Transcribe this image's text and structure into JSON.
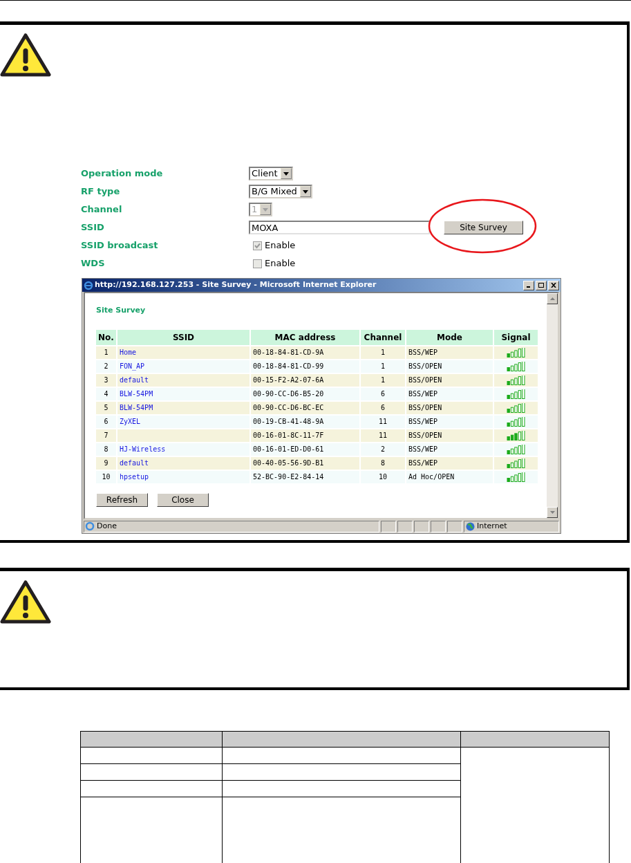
{
  "settings": [
    {
      "label": "Operation mode",
      "kind": "select",
      "value": "Client",
      "disabled": false
    },
    {
      "label": "RF type",
      "kind": "select",
      "value": "B/G Mixed",
      "disabled": false
    },
    {
      "label": "Channel",
      "kind": "select",
      "value": "1",
      "disabled": true
    },
    {
      "label": "SSID",
      "kind": "text",
      "value": "MOXA",
      "button": "Site Survey"
    },
    {
      "label": "SSID broadcast",
      "kind": "checkbox",
      "text": "Enable",
      "checked": true,
      "disabled": true
    },
    {
      "label": "WDS",
      "kind": "checkbox",
      "text": "Enable",
      "checked": false,
      "disabled": true
    }
  ],
  "popup": {
    "title": "http://192.168.127.253 - Site Survey - Microsoft Internet Explorer",
    "heading": "Site Survey",
    "columns": [
      "No.",
      "SSID",
      "MAC address",
      "Channel",
      "Mode",
      "Signal"
    ],
    "rows": [
      {
        "no": "1",
        "ssid": "Home",
        "mac": "00-18-84-81-CD-9A",
        "channel": "1",
        "mode": "BSS/WEP",
        "level": 0.2
      },
      {
        "no": "2",
        "ssid": "FON_AP",
        "mac": "00-18-84-81-CD-99",
        "channel": "1",
        "mode": "BSS/OPEN",
        "level": 0.2
      },
      {
        "no": "3",
        "ssid": "default",
        "mac": "00-15-F2-A2-07-6A",
        "channel": "1",
        "mode": "BSS/OPEN",
        "level": 0.2
      },
      {
        "no": "4",
        "ssid": "BLW-54PM",
        "mac": "00-90-CC-D6-B5-20",
        "channel": "6",
        "mode": "BSS/WEP",
        "level": 0.2
      },
      {
        "no": "5",
        "ssid": "BLW-54PM",
        "mac": "00-90-CC-D6-BC-EC",
        "channel": "6",
        "mode": "BSS/OPEN",
        "level": 0.2
      },
      {
        "no": "6",
        "ssid": "ZyXEL",
        "mac": "00-19-CB-41-48-9A",
        "channel": "11",
        "mode": "BSS/WEP",
        "level": 0.2
      },
      {
        "no": "7",
        "mac": "00-16-01-8C-11-7F",
        "channel": "11",
        "mode": "BSS/OPEN",
        "level": 0.6
      },
      {
        "no": "8",
        "ssid": "HJ-Wireless",
        "mac": "00-16-01-ED-D0-61",
        "channel": "2",
        "mode": "BSS/WEP",
        "level": 0.2
      },
      {
        "no": "9",
        "ssid": "default",
        "mac": "00-40-05-56-9D-B1",
        "channel": "8",
        "mode": "BSS/WEP",
        "level": 0.2
      },
      {
        "no": "10",
        "ssid": "hpsetup",
        "mac": "52-BC-90-E2-84-14",
        "channel": "10",
        "mode": "Ad Hoc/OPEN",
        "level": 0.2
      }
    ],
    "buttons": [
      "Refresh",
      "Close"
    ],
    "status": "Done",
    "zone": "Internet"
  }
}
